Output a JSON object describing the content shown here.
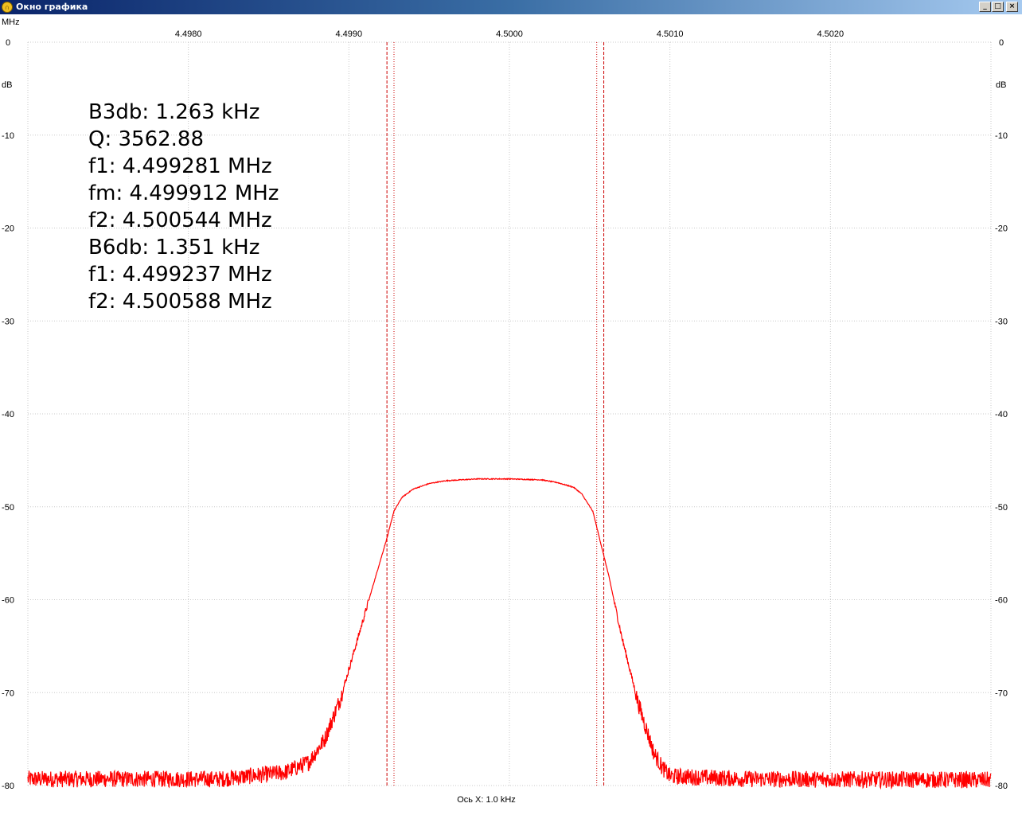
{
  "window": {
    "title": "Окно графика",
    "icon": "app-logo-icon",
    "buttons": {
      "minimize": "_",
      "maximize": "□",
      "close": "×"
    }
  },
  "colors": {
    "trace": "#ff0000",
    "marker": "#cc0000",
    "grid": "#c8c8c8",
    "titlebar": "#0a246a"
  },
  "chart_data": {
    "type": "line",
    "x_unit": "MHz",
    "y_unit": "dB",
    "xlabel": "Ось X: 1.0 kHz",
    "xlim": [
      4.497,
      4.503
    ],
    "ylim": [
      -80,
      0
    ],
    "x_ticks": [
      4.498,
      4.499,
      4.5,
      4.501,
      4.502
    ],
    "x_tick_labels": [
      "4.4980",
      "4.4990",
      "4.5000",
      "4.5010",
      "4.5020"
    ],
    "y_ticks": [
      0,
      -10,
      -20,
      -30,
      -40,
      -50,
      -60,
      -70,
      -80
    ],
    "y_tick_labels": [
      "0",
      "-10",
      "-20",
      "-30",
      "-40",
      "-50",
      "-60",
      "-70",
      "-80"
    ],
    "grid": true,
    "series": [
      {
        "values_hint": "filter response",
        "x": [
          4.497,
          4.4982,
          4.4986,
          4.49875,
          4.49885,
          4.49895,
          4.49905,
          4.49915,
          4.49924,
          4.49928,
          4.49933,
          4.4994,
          4.4995,
          4.4996,
          4.4998,
          4.5,
          4.5002,
          4.5003,
          4.5004,
          4.50045,
          4.50052,
          4.50056,
          4.50062,
          4.5007,
          4.5008,
          4.5009,
          4.50095,
          4.501,
          4.5015,
          4.503
        ],
        "y": [
          -79.3,
          -79.3,
          -78.6,
          -77.5,
          -75,
          -70.5,
          -64.5,
          -58.5,
          -53.2,
          -50.5,
          -49,
          -48.1,
          -47.5,
          -47.2,
          -47,
          -47,
          -47.1,
          -47.4,
          -47.9,
          -48.6,
          -50.5,
          -53.3,
          -57.5,
          -64,
          -71,
          -76.5,
          -78,
          -79,
          -79.3,
          -79.4
        ]
      }
    ],
    "markers": [
      {
        "label": "B6db f1",
        "x": 4.499237,
        "style": "dashed"
      },
      {
        "label": "B3db f1",
        "x": 4.499281,
        "style": "dotted"
      },
      {
        "label": "B3db f2",
        "x": 4.500544,
        "style": "dotted"
      },
      {
        "label": "B6db f2",
        "x": 4.500588,
        "style": "dashed"
      }
    ],
    "annotations": [
      "B3db: 1.263 kHz",
      "Q: 3562.88",
      "f1: 4.499281 MHz",
      "fm: 4.499912 MHz",
      "f2: 4.500544 MHz",
      "B6db: 1.351 kHz",
      "f1: 4.499237 MHz",
      "f2: 4.500588 MHz"
    ]
  }
}
